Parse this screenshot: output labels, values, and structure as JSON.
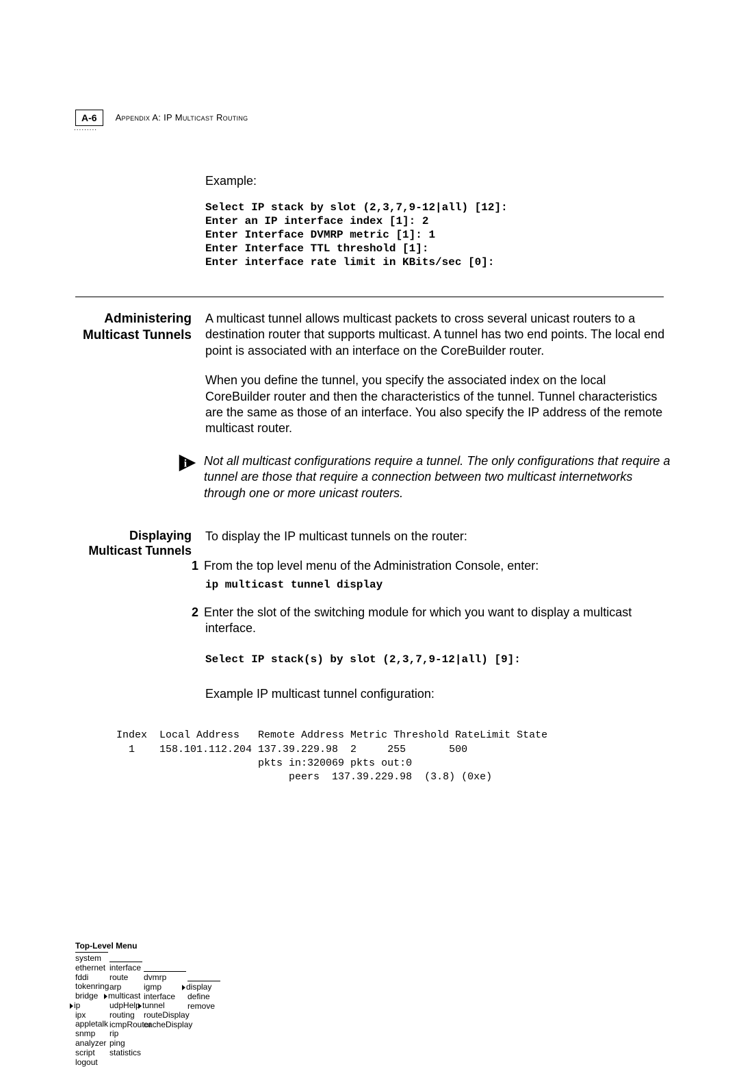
{
  "header": {
    "page_num": "A-6",
    "appendix_title": "Appendix A: IP Multicast Routing",
    "dots": "........."
  },
  "example": {
    "label": "Example:",
    "lines": "Select IP stack by slot (2,3,7,9-12|all) [12]:\nEnter an IP interface index [1]: 2\nEnter Interface DVMRP metric [1]: 1\nEnter Interface TTL threshold [1]:\nEnter interface rate limit in KBits/sec [0]:"
  },
  "section1": {
    "title": "Administering Multicast Tunnels",
    "para1": "A multicast tunnel allows multicast packets to cross several unicast routers to a destination router that supports multicast. A tunnel has two end points. The local end point is associated with an interface on the CoreBuilder router.",
    "para2": "When you define the tunnel, you specify the associated index on the local CoreBuilder router and then the characteristics of the tunnel. Tunnel characteristics are the same as those of an interface. You also specify the IP address of the remote multicast router.",
    "note": "Not all multicast configurations require a tunnel. The only configurations that require a tunnel are those that require a connection between two multicast internetworks through one or more unicast routers."
  },
  "section2": {
    "title": "Displaying Multicast Tunnels",
    "intro": "To display the IP multicast tunnels on the router:",
    "step1_num": "1",
    "step1": "From the top level menu of the Administration Console, enter:",
    "cmd1": "ip multicast tunnel display",
    "step2_num": "2",
    "step2": "Enter the slot of the switching module for which you want to display a multicast interface.",
    "prompt": "Select IP stack(s) by slot (2,3,7,9-12|all) [9]:",
    "example_cfg": "Example IP multicast tunnel configuration:",
    "table": "Index  Local Address   Remote Address Metric Threshold RateLimit State\n  1    158.101.112.204 137.39.229.98  2     255       500\n                       pkts in:320069 pkts out:0\n                            peers  137.39.229.98  (3.8) (0xe)"
  },
  "menu": {
    "title": "Top-Level Menu",
    "col1": [
      "system",
      "ethernet",
      "fddi",
      "tokenring",
      "bridge",
      "ip",
      "ipx",
      "appletalk",
      "snmp",
      "analyzer",
      "script",
      "logout"
    ],
    "col2": [
      "interface",
      "route",
      "arp",
      "multicast",
      "udpHelp",
      "routing",
      "icmpRouter",
      "rip",
      "ping",
      "statistics"
    ],
    "col3": [
      "dvmrp",
      "igmp",
      "interface",
      "tunnel",
      "routeDisplay",
      "cacheDisplay"
    ],
    "col4": [
      "display",
      "define",
      "remove"
    ],
    "arrow_col1": "ip",
    "arrow_col2": "multicast",
    "arrow_col3": "tunnel",
    "arrow_col4": "display"
  }
}
